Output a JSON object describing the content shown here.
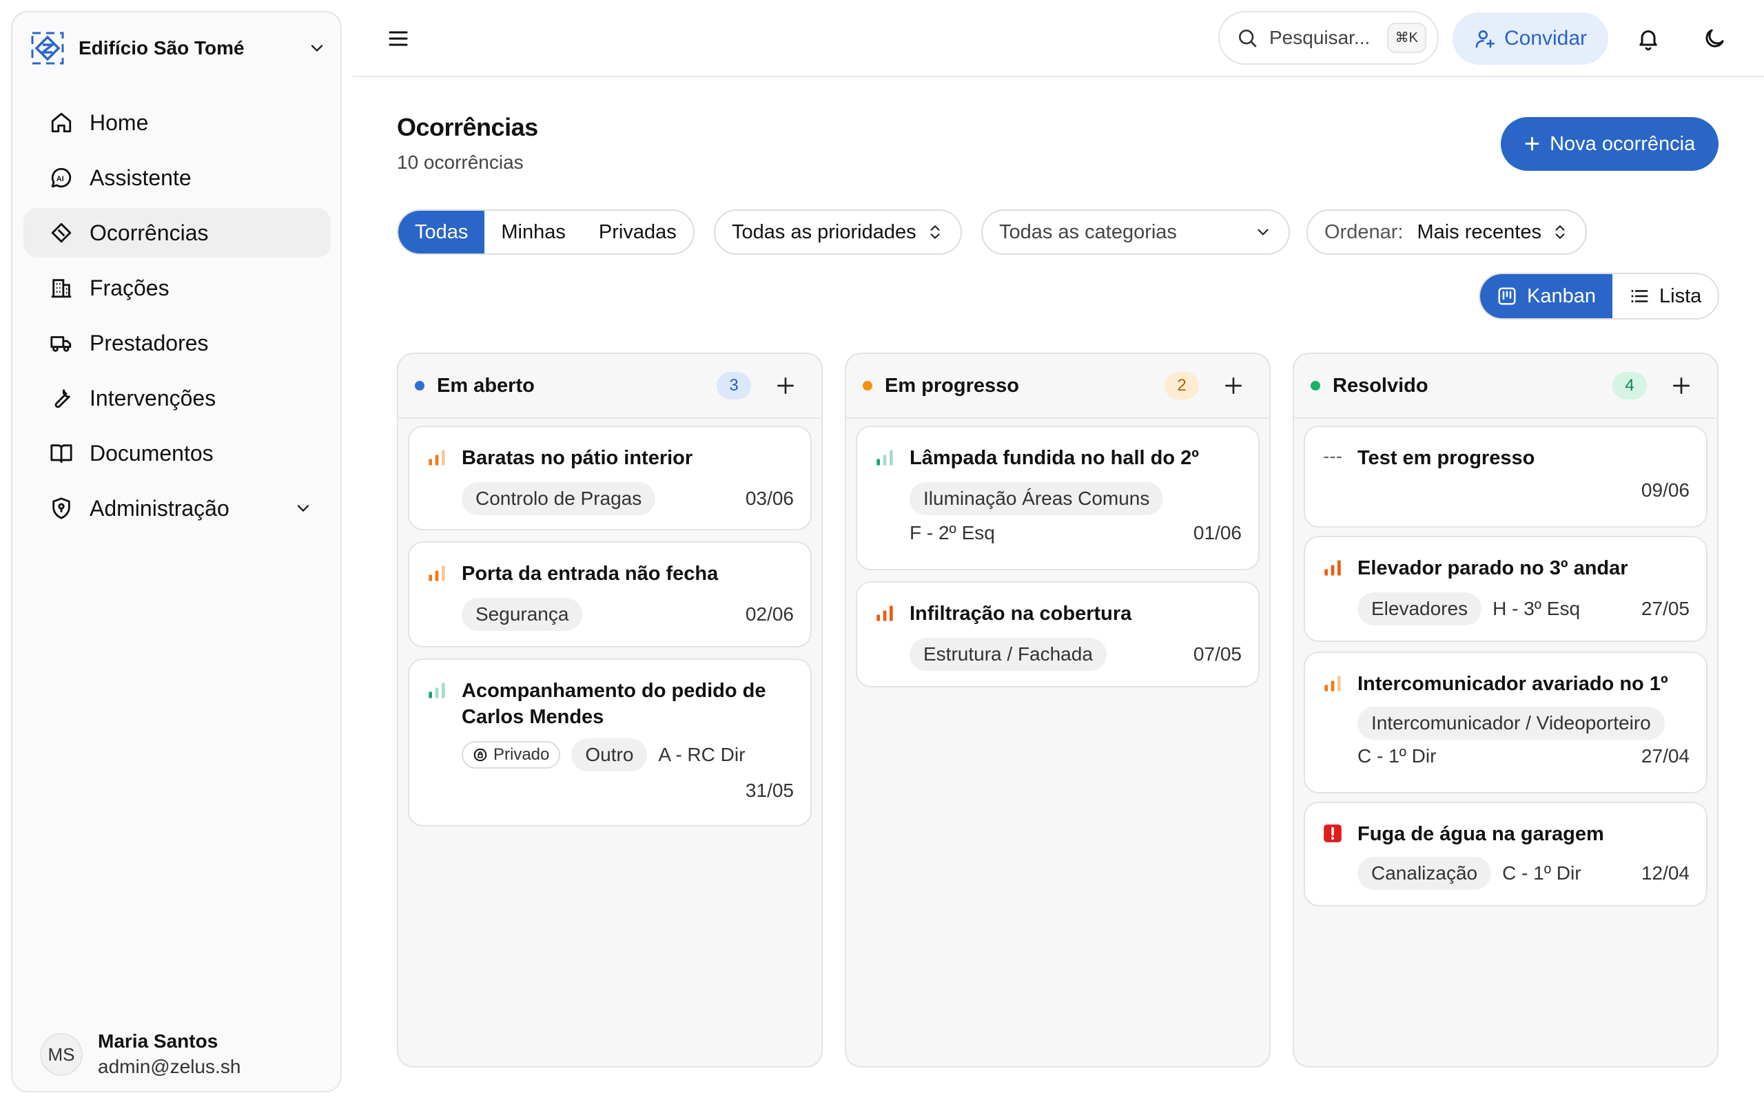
{
  "org": {
    "name": "Edifício São Tomé"
  },
  "nav": [
    {
      "label": "Home"
    },
    {
      "label": "Assistente"
    },
    {
      "label": "Ocorrências"
    },
    {
      "label": "Frações"
    },
    {
      "label": "Prestadores"
    },
    {
      "label": "Intervenções"
    },
    {
      "label": "Documentos"
    },
    {
      "label": "Administração"
    }
  ],
  "user": {
    "initials": "MS",
    "name": "Maria Santos",
    "email": "admin@zelus.sh"
  },
  "topbar": {
    "search_placeholder": "Pesquisar...",
    "shortcut": "⌘K",
    "invite_label": "Convidar"
  },
  "page": {
    "title": "Ocorrências",
    "subtitle": "10 ocorrências",
    "new_button": "Nova ocorrência"
  },
  "filters": {
    "scope": [
      "Todas",
      "Minhas",
      "Privadas"
    ],
    "priority": "Todas as prioridades",
    "category": "Todas as categorias",
    "order_label": "Ordenar:",
    "order_value": "Mais recentes"
  },
  "views": {
    "kanban": "Kanban",
    "list": "Lista"
  },
  "columns": [
    {
      "title": "Em aberto",
      "count": "3",
      "color": "#2f6fd6",
      "cards": [
        {
          "title": "Baratas no pátio interior",
          "priority": "medium",
          "category": "Controlo de Pragas",
          "unit": "",
          "date": "03/06"
        },
        {
          "title": "Porta da entrada não fecha",
          "priority": "medium",
          "category": "Segurança",
          "unit": "",
          "date": "02/06"
        },
        {
          "title": "Acompanhamento do pedido de Carlos Mendes",
          "priority": "low",
          "private_label": "Privado",
          "category": "Outro",
          "unit": "A - RC Dir",
          "date": "31/05"
        }
      ]
    },
    {
      "title": "Em progresso",
      "count": "2",
      "color": "#f5930b",
      "cards": [
        {
          "title": "Lâmpada fundida no hall do 2º",
          "priority": "low",
          "category": "Iluminação Áreas Comuns",
          "unit": "F - 2º Esq",
          "date": "01/06"
        },
        {
          "title": "Infiltração na cobertura",
          "priority": "high",
          "category": "Estrutura / Fachada",
          "unit": "",
          "date": "07/05"
        }
      ]
    },
    {
      "title": "Resolvido",
      "count": "4",
      "color": "#17b26a",
      "cards": [
        {
          "title": "Test em progresso",
          "priority": "none",
          "category": "",
          "unit": "",
          "date": "09/06"
        },
        {
          "title": "Elevador parado no 3º andar",
          "priority": "high",
          "category": "Elevadores",
          "unit": "H - 3º Esq",
          "date": "27/05"
        },
        {
          "title": "Intercomunicador avariado no 1º",
          "priority": "medium",
          "category": "Intercomunicador / Videoporteiro",
          "unit": "C - 1º Dir",
          "date": "27/04"
        },
        {
          "title": "Fuga de água na garagem",
          "priority": "urgent",
          "category": "Canalização",
          "unit": "C - 1º Dir",
          "date": "12/04"
        }
      ]
    }
  ]
}
